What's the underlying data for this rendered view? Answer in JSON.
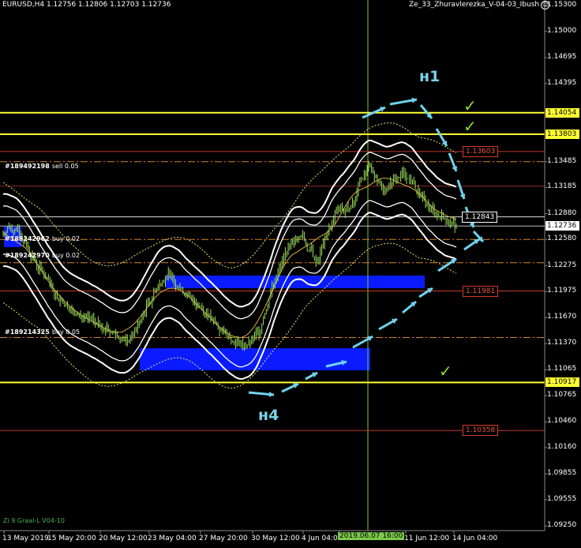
{
  "header": {
    "symbol_info": "EURUSD,H4  1.12756 1.12806 1.12703 1.12736",
    "expert_name": "Ze_33_Zhuravlerezka_V-04-03_Ibush"
  },
  "price_axis": {
    "labels": [
      "1.15300",
      "1.15000",
      "1.14695",
      "1.14395",
      "1.13485",
      "1.13185",
      "1.12880",
      "1.12580",
      "1.12275",
      "1.11975",
      "1.11670",
      "1.11370",
      "1.11065",
      "1.10765",
      "1.10460",
      "1.10160",
      "1.09855",
      "1.09555",
      "1.09250"
    ]
  },
  "price_tags": [
    {
      "text": "1.14054",
      "style": "yellow"
    },
    {
      "text": "1.13803",
      "style": "yellow"
    },
    {
      "text": "1.12736",
      "style": "current"
    },
    {
      "text": "1.10917",
      "style": "yellow"
    }
  ],
  "level_boxes": [
    {
      "text": "1.13603",
      "style": "red"
    },
    {
      "text": "1.12843",
      "style": "white"
    },
    {
      "text": "1.11981",
      "style": "red"
    },
    {
      "text": "1.10358",
      "style": "red"
    }
  ],
  "trade_labels": [
    {
      "ticket": "#189492198",
      "side": "sell 0.05"
    },
    {
      "ticket": "#189242962",
      "side": "buy 0.02"
    },
    {
      "ticket": "#189242970",
      "side": "buy 0.02"
    },
    {
      "ticket": "#189214325",
      "side": "buy 0.05"
    }
  ],
  "time_axis": {
    "labels": [
      "13 May 2019",
      "15 May 20:00",
      "20 May 12:00",
      "23 May 04:00",
      "27 May 20:00",
      "30 May 12:00",
      "4 Jun 04:00",
      "2019.06.07 16:00",
      "11 Jun 12:00",
      "14 Jun 04:00"
    ]
  },
  "annotations": {
    "h1": "н1",
    "h4": "н4",
    "check": "✓"
  },
  "indicator_name": "Zi 9 Graal-L V04-10",
  "colors": {
    "background": "#000000",
    "candles": "#9bdc5a",
    "yellow_level": "#ffff33",
    "red_level": "#c0392b",
    "orange_dashed": "#d9822b",
    "blue_zone": "#0a1cff",
    "arrows": "#6fd3ee",
    "bands": "#ffffff",
    "vertical_line": "#6ecf3a",
    "check": "#8fdc2a"
  },
  "chart_data": {
    "type": "candlestick",
    "symbol": "EURUSD",
    "timeframe": "H4",
    "ohlc_last": {
      "open": 1.12756,
      "high": 1.12806,
      "low": 1.12703,
      "close": 1.12736
    },
    "ylim": [
      1.0915,
      1.154
    ],
    "ytick_labels": [
      "1.15300",
      "1.15000",
      "1.14695",
      "1.14395",
      "1.13485",
      "1.13185",
      "1.12880",
      "1.12580",
      "1.12275",
      "1.11975",
      "1.11670",
      "1.11370",
      "1.11065",
      "1.10765",
      "1.10460",
      "1.10160",
      "1.09855",
      "1.09555",
      "1.09250"
    ],
    "xtick_labels": [
      "13 May 2019",
      "15 May 20:00",
      "20 May 12:00",
      "23 May 04:00",
      "27 May 20:00",
      "30 May 12:00",
      "4 Jun 04:00",
      "2019.06.07 16:00",
      "11 Jun 12:00",
      "14 Jun 04:00"
    ],
    "horizontal_levels": [
      {
        "price": 1.14054,
        "kind": "yellow"
      },
      {
        "price": 1.13803,
        "kind": "yellow"
      },
      {
        "price": 1.10917,
        "kind": "yellow"
      },
      {
        "price": 1.13603,
        "kind": "red"
      },
      {
        "price": 1.11981,
        "kind": "red"
      },
      {
        "price": 1.10358,
        "kind": "red"
      },
      {
        "price": 1.12843,
        "kind": "white"
      },
      {
        "price": 1.12736,
        "kind": "current"
      }
    ],
    "close_path": [
      1.1265,
      1.1272,
      1.1268,
      1.1258,
      1.1238,
      1.1225,
      1.1212,
      1.1196,
      1.1188,
      1.118,
      1.117,
      1.1168,
      1.1164,
      1.116,
      1.1155,
      1.115,
      1.1145,
      1.114,
      1.115,
      1.1165,
      1.1185,
      1.12,
      1.1212,
      1.1218,
      1.1205,
      1.1195,
      1.1188,
      1.118,
      1.1172,
      1.1162,
      1.1152,
      1.1145,
      1.1138,
      1.1135,
      1.1138,
      1.115,
      1.1175,
      1.1205,
      1.1228,
      1.1245,
      1.1258,
      1.1262,
      1.1245,
      1.1232,
      1.1255,
      1.1275,
      1.1295,
      1.129,
      1.13,
      1.133,
      1.134,
      1.1332,
      1.1318,
      1.1322,
      1.133,
      1.1335,
      1.1325,
      1.131,
      1.1298,
      1.1292,
      1.1285,
      1.1278,
      1.1274
    ]
  }
}
